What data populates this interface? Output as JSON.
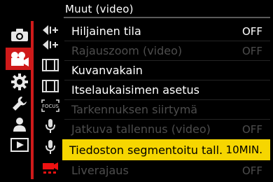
{
  "header": {
    "title": "Muut (video)"
  },
  "tabs": [
    {
      "icon": "camera-icon",
      "active": false
    },
    {
      "icon": "video-camera-icon",
      "active": true
    },
    {
      "icon": "gear-icon",
      "active": false
    },
    {
      "icon": "wrench-icon",
      "active": false
    },
    {
      "icon": "person-icon",
      "active": false
    },
    {
      "icon": "playback-icon",
      "active": false
    }
  ],
  "subtabs": [
    {
      "icon": "exposure-arrows-icon",
      "label": ""
    },
    {
      "icon": "exposure-arrows-icon",
      "label": ""
    },
    {
      "icon": "film-frame-icon",
      "label": ""
    },
    {
      "icon": "film-frame-icon",
      "label": ""
    },
    {
      "icon": "focus-frame-icon",
      "label": "FOCUS"
    },
    {
      "icon": "microphone-icon",
      "label": ""
    },
    {
      "icon": "microphone-icon",
      "label": ""
    },
    {
      "icon": "video-other-icon",
      "label": ""
    }
  ],
  "menu": {
    "items": [
      {
        "label": "Hiljainen tila",
        "value": "OFF",
        "enabled": true,
        "selected": false
      },
      {
        "label": "Rajauszoom (video)",
        "value": "OFF",
        "enabled": false,
        "selected": false
      },
      {
        "label": "Kuvanvakain",
        "value": "",
        "enabled": true,
        "selected": false
      },
      {
        "label": "Itselaukaisimen asetus",
        "value": "",
        "enabled": true,
        "selected": false
      },
      {
        "label": "Tarkennuksen siirtymä",
        "value": "",
        "enabled": false,
        "selected": false
      },
      {
        "label": "Jatkuva tallennus (video)",
        "value": "OFF",
        "enabled": false,
        "selected": false
      },
      {
        "label": "Tiedoston segmentoitu tall.",
        "value": "10MIN.",
        "enabled": true,
        "selected": true
      },
      {
        "label": "Liverajaus",
        "value": "OFF",
        "enabled": false,
        "selected": false
      }
    ]
  },
  "colors": {
    "accent_red": "#cf1a1a",
    "highlight_yellow": "#f6d600",
    "dim_text": "#4d4d4d"
  }
}
